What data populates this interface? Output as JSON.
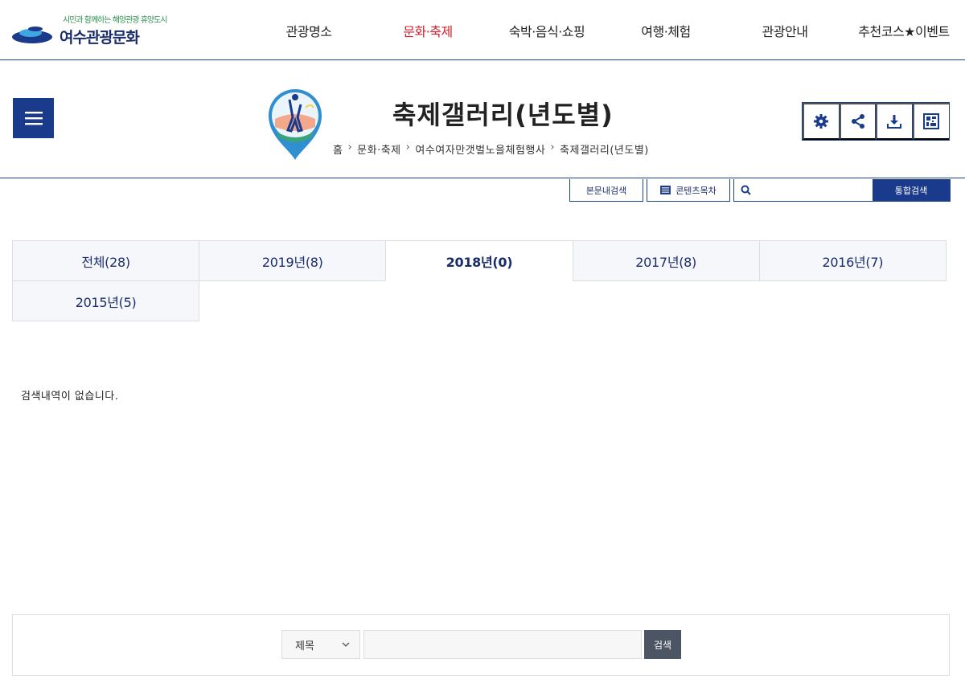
{
  "header": {
    "logo_tagline": "시민과 함께하는 해양관광 휴양도시",
    "logo_name": "여수관광문화",
    "nav": [
      {
        "label": "관광명소"
      },
      {
        "label": "문화·축제"
      },
      {
        "label": "숙박·음식·쇼핑"
      },
      {
        "label": "여행·체험"
      },
      {
        "label": "관광안내"
      },
      {
        "label": "추천코스★이벤트"
      }
    ],
    "active_nav": "문화·축제"
  },
  "title_area": {
    "page_title": "축제갤러리(년도별)",
    "breadcrumb": [
      "홈",
      "문화·축제",
      "여수여자만갯벌노을체험행사",
      "축제갤러리(년도별)"
    ],
    "tools": [
      "gear-icon",
      "share-icon",
      "download-icon",
      "qr-code-icon"
    ]
  },
  "util": {
    "in_page_search": "본문내검색",
    "toc": "콘텐츠목차",
    "search_placeholder": "",
    "search_button": "통합검색"
  },
  "tabs": [
    {
      "label": "전체(28)"
    },
    {
      "label": "2019년(8)"
    },
    {
      "label": "2018년(0)"
    },
    {
      "label": "2017년(8)"
    },
    {
      "label": "2016년(7)"
    },
    {
      "label": "2015년(5)"
    }
  ],
  "active_tab": "2018년(0)",
  "empty_message": "검색내역이 없습니다.",
  "bottom_search": {
    "field_selected": "제목",
    "query_value": "",
    "submit_label": "검색"
  },
  "colors": {
    "primary": "#1a3a8c",
    "active_nav": "#d31f2b",
    "submit_gray": "#4b5564"
  }
}
